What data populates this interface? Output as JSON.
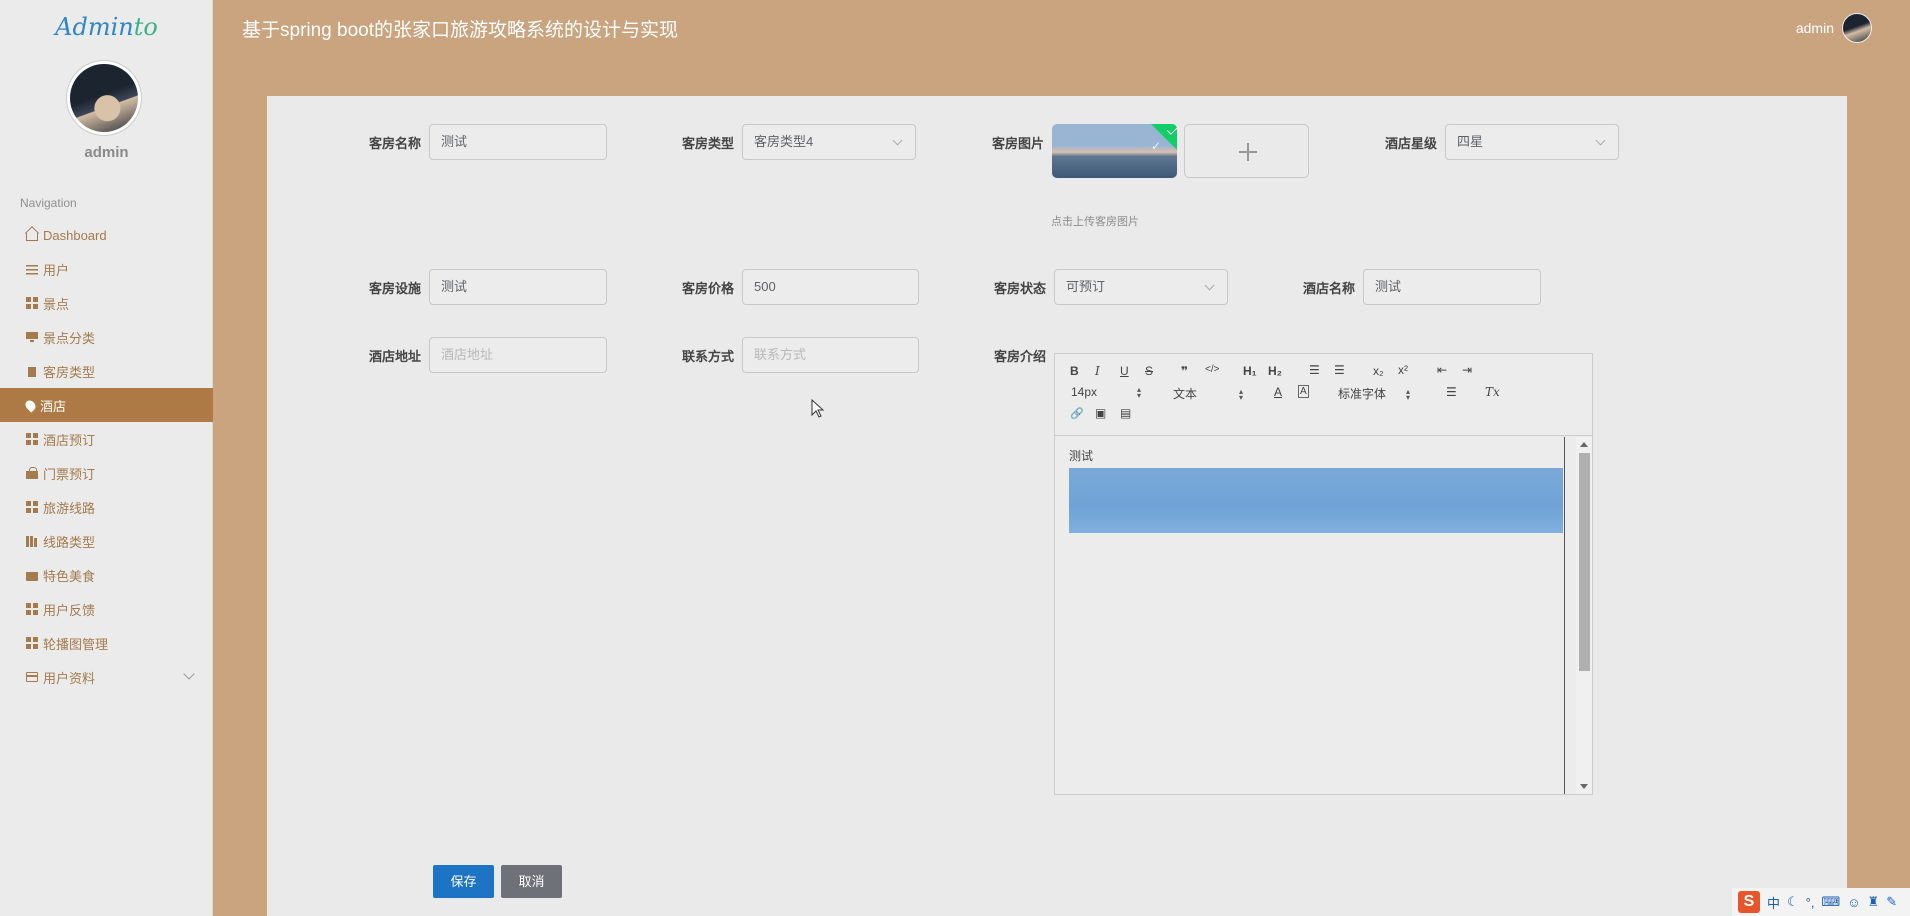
{
  "sidebar": {
    "logo_main": "Admin",
    "logo_accent": "to",
    "username": "admin",
    "nav_title": "Navigation",
    "items": [
      {
        "label": "Dashboard",
        "icon": "home-icon"
      },
      {
        "label": "用户",
        "icon": "sliders-icon"
      },
      {
        "label": "景点",
        "icon": "grid-icon"
      },
      {
        "label": "景点分类",
        "icon": "monitor-icon"
      },
      {
        "label": "客房类型",
        "icon": "clipboard-icon"
      },
      {
        "label": "酒店",
        "icon": "map-pin-icon"
      },
      {
        "label": "酒店预订",
        "icon": "grid-icon"
      },
      {
        "label": "门票预订",
        "icon": "bag-icon"
      },
      {
        "label": "旅游线路",
        "icon": "grid-icon"
      },
      {
        "label": "线路类型",
        "icon": "books-icon"
      },
      {
        "label": "特色美食",
        "icon": "wallet-icon"
      },
      {
        "label": "用户反馈",
        "icon": "grid-icon"
      },
      {
        "label": "轮播图管理",
        "icon": "grid-icon"
      },
      {
        "label": "用户资料",
        "icon": "card-icon"
      }
    ],
    "active_item": "酒店"
  },
  "header": {
    "title": "基于spring boot的张家口旅游攻略系统的设计与实现",
    "user": "admin"
  },
  "form": {
    "room_name": {
      "label": "客房名称",
      "value": "测试"
    },
    "room_type": {
      "label": "客房类型",
      "value": "客房类型4"
    },
    "room_image": {
      "label": "客房图片",
      "tip": "点击上传客房图片"
    },
    "hotel_star": {
      "label": "酒店星级",
      "value": "四星"
    },
    "room_facility": {
      "label": "客房设施",
      "value": "测试"
    },
    "room_price": {
      "label": "客房价格",
      "value": "500"
    },
    "room_status": {
      "label": "客房状态",
      "value": "可预订"
    },
    "hotel_name": {
      "label": "酒店名称",
      "value": "测试"
    },
    "hotel_address": {
      "label": "酒店地址",
      "placeholder": "酒店地址"
    },
    "contact": {
      "label": "联系方式",
      "placeholder": "联系方式"
    },
    "room_intro": {
      "label": "客房介绍",
      "content_text": "测试"
    }
  },
  "editor": {
    "font_size": "14px",
    "format": "文本",
    "font_family": "标准字体",
    "buttons": {
      "bold": "B",
      "italic": "I",
      "underline": "U",
      "strike": "S",
      "quote": "❞",
      "code": "</>",
      "h1": "H₁",
      "h2": "H₂",
      "ol": "☰",
      "ul": "☰",
      "sub": "x₂",
      "sup": "x²",
      "outdent": "⇤",
      "indent": "⇥",
      "color": "A",
      "background": "A",
      "align": "☰",
      "clean": "Tx",
      "link": "🔗",
      "image": "▣",
      "video": "▤"
    }
  },
  "actions": {
    "save": "保存",
    "cancel": "取消"
  },
  "ime": {
    "logo": "S",
    "lang": "中"
  },
  "colors": {
    "page_bg": "#c9a47f",
    "sidebar_bg": "#ebebeb",
    "active_nav": "#ad7a45",
    "primary_button": "#1d74c4",
    "cancel_button": "#6e7178",
    "upload_success": "#13ce66"
  }
}
